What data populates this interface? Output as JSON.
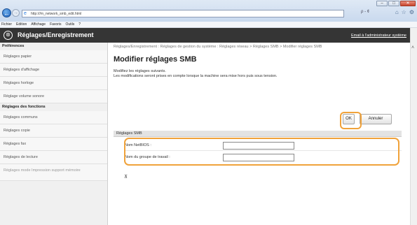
{
  "browser": {
    "url": "http://",
    "url_masked": "",
    "url_tail": "/m_network_smb_edit.html",
    "addr_tools": "ρ - ¢",
    "icons": [
      "home-icon",
      "star-icon",
      "gear-icon"
    ],
    "window_controls": [
      "–",
      "□",
      "✕"
    ]
  },
  "menubar": {
    "items": [
      "Fichier",
      "Edition",
      "Affichage",
      "Favoris",
      "Outils",
      "?"
    ]
  },
  "header": {
    "title": "Réglages/Enregistrement",
    "mail_link": "Email à l'administrateur système"
  },
  "sidebar": {
    "sections": [
      {
        "heading": "Préférences",
        "items": [
          "Réglages papier",
          "Réglages d'affichage",
          "Réglages horloge",
          "Réglage volume sonore"
        ]
      },
      {
        "heading": "Réglages des fonctions",
        "items": [
          "Réglages communs",
          "Réglages copie",
          "Réglages fax",
          "Réglages de lecture",
          "Réglages mode Impression support mémoire"
        ]
      }
    ]
  },
  "main": {
    "breadcrumb": "Réglages/Enregistrement : Réglages de gestion du système : Réglages réseau > Réglages SMB > Modifier réglages SMB",
    "title": "Modifier réglages SMB",
    "desc_line1": "Modifiez les réglages suivants.",
    "desc_line2": "Les modifications seront prises en compte lorsque la machine sera mise hors puis sous tension.",
    "ok_label": "OK",
    "cancel_label": "Annuler",
    "section_title": "Réglages SMB",
    "fields": [
      {
        "label": "Nom NetBIOS :",
        "value": ""
      },
      {
        "label": "Nom du groupe de travail :",
        "value": ""
      }
    ],
    "to_top": "⊼"
  },
  "colors": {
    "header_bg": "#353535",
    "highlight": "#f0a23a",
    "sidebar_bg": "#f0f0f0"
  }
}
